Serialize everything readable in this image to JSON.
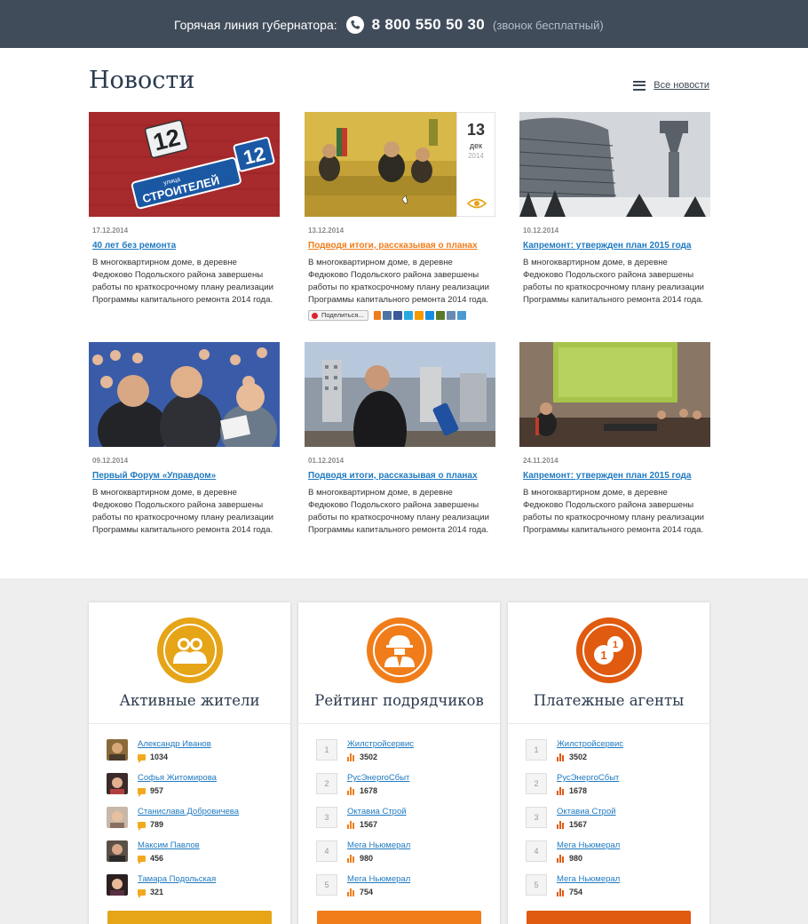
{
  "topbar": {
    "hotline_label": "Горячая линия губернатора:",
    "phone": "8 800 550 50 30",
    "note": "(звонок бесплатный)"
  },
  "news": {
    "title": "Новости",
    "all_link": "Все новости",
    "items": [
      {
        "date": "17.12.2014",
        "title": "40 лет без ремонта",
        "text": "В многоквартирном доме, в деревне Федюково Подольского района завершены работы по краткосрочному плану реализации Программы капитального ремонта 2014 года.",
        "sign_word": "улица",
        "sign_street": "СТРОИТЕЛЕЙ",
        "sign_num": "12"
      },
      {
        "date": "13.12.2014",
        "title": "Подводя итоги, рассказывая о планах",
        "text": "В многоквартирном доме, в деревне Федюково Подольского района завершены работы по краткосрочному плану реализации Программы капитального ремонта 2014 года.",
        "badge": {
          "day": "13",
          "month": "дек",
          "year": "2014"
        },
        "share_label": "Поделиться..."
      },
      {
        "date": "10.12.2014",
        "title": "Капремонт: утвержден план 2015 года",
        "text": "В многоквартирном доме, в деревне Федюково Подольского района завершены работы по краткосрочному плану реализации Программы капитального ремонта 2014 года."
      },
      {
        "date": "09.12.2014",
        "title": "Первый Форум «Управдом»",
        "text": "В многоквартирном доме, в деревне Федюково Подольского района завершены работы по краткосрочному плану реализации Программы капитального ремонта 2014 года."
      },
      {
        "date": "01.12.2014",
        "title": "Подводя итоги, рассказывая о планах",
        "text": "В многоквартирном доме, в деревне Федюково Подольского района завершены работы по краткосрочному плану реализации Программы капитального ремонта 2014 года."
      },
      {
        "date": "24.11.2014",
        "title": "Капремонт: утвержден план 2015 года",
        "text": "В многоквартирном доме, в деревне Федюково Подольского района завершены работы по краткосрочному плану реализации Программы капитального ремонта 2014 года."
      }
    ]
  },
  "panels": [
    {
      "title": "Активные жители",
      "accent": "#e6a417",
      "rows": [
        {
          "name": "Александр Иванов",
          "value": "1034"
        },
        {
          "name": "Софья Житомирова",
          "value": "957"
        },
        {
          "name": "Станислава Добровичева",
          "value": "789"
        },
        {
          "name": "Максим Павлов",
          "value": "456"
        },
        {
          "name": "Тамара Подольская",
          "value": "321"
        }
      ]
    },
    {
      "title": "Рейтинг подрядчиков",
      "accent": "#f07d1a",
      "rows": [
        {
          "rank": "1",
          "name": "Жилстройсервис",
          "value": "3502"
        },
        {
          "rank": "2",
          "name": "РусЭнергоСбыт",
          "value": "1678"
        },
        {
          "rank": "3",
          "name": "Октавиа Строй",
          "value": "1567"
        },
        {
          "rank": "4",
          "name": "Мега Ньюмерал",
          "value": "980"
        },
        {
          "rank": "5",
          "name": "Мега Ньюмерал",
          "value": "754"
        }
      ]
    },
    {
      "title": "Платежные агенты",
      "accent": "#e05a10",
      "rows": [
        {
          "rank": "1",
          "name": "Жилстройсервис",
          "value": "3502"
        },
        {
          "rank": "2",
          "name": "РусЭнергоСбыт",
          "value": "1678"
        },
        {
          "rank": "3",
          "name": "Октавиа Строй",
          "value": "1567"
        },
        {
          "rank": "4",
          "name": "Мега Ньюмерал",
          "value": "980"
        },
        {
          "rank": "5",
          "name": "Мега Ньюмерал",
          "value": "754"
        }
      ]
    }
  ]
}
